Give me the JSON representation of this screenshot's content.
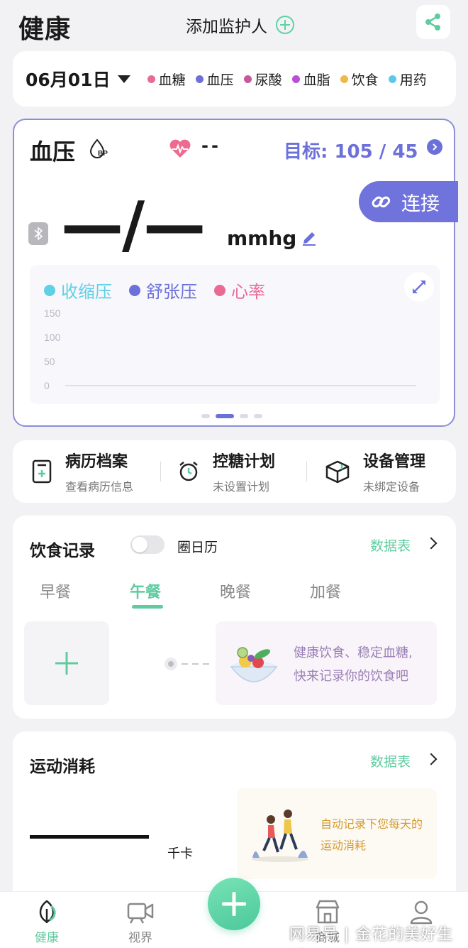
{
  "header": {
    "title": "健康",
    "add_guardian_label": "添加监护人"
  },
  "date_bar": {
    "date": "06月01日",
    "legend": [
      {
        "label": "血糖",
        "color": "#e96b93"
      },
      {
        "label": "血压",
        "color": "#6c70d9"
      },
      {
        "label": "尿酸",
        "color": "#c8569a"
      },
      {
        "label": "血脂",
        "color": "#b84fd6"
      },
      {
        "label": "饮食",
        "color": "#f0b84a"
      },
      {
        "label": "用药",
        "color": "#5cc9ea"
      }
    ]
  },
  "bp_card": {
    "title": "血压",
    "badge": "BP",
    "heart_rate": "--",
    "target_label": "目标:",
    "target_value": "105 / 45",
    "connect_label": "连接",
    "reading": "—/—",
    "unit": "mmhg",
    "chart_legend": [
      {
        "label": "收缩压",
        "color": "#5fd0e6"
      },
      {
        "label": "舒张压",
        "color": "#6c70d9"
      },
      {
        "label": "心率",
        "color": "#e96b93"
      }
    ],
    "accent": "#6c70d9"
  },
  "chart_data": {
    "type": "line",
    "series": [
      {
        "name": "收缩压",
        "values": []
      },
      {
        "name": "舒张压",
        "values": []
      },
      {
        "name": "心率",
        "values": []
      }
    ],
    "yticks": [
      "150",
      "100",
      "50",
      "0"
    ],
    "ylim": [
      0,
      150
    ],
    "grid": false,
    "legend": "top-left"
  },
  "menu": [
    {
      "title": "病历档案",
      "subtitle": "查看病历信息",
      "icon": "medical-record-icon"
    },
    {
      "title": "控糖计划",
      "subtitle": "未设置计划",
      "icon": "alarm-clock-icon"
    },
    {
      "title": "设备管理",
      "subtitle": "未绑定设备",
      "icon": "box-icon"
    }
  ],
  "diet": {
    "title": "饮食记录",
    "toggle_label": "圈日历",
    "data_link": "数据表",
    "tabs": [
      "早餐",
      "午餐",
      "晚餐",
      "加餐"
    ],
    "active_tab": "午餐",
    "tip_line1": "健康饮食、稳定血糖,",
    "tip_line2": "快来记录你的饮食吧"
  },
  "sport": {
    "title": "运动消耗",
    "data_link": "数据表",
    "unit": "千卡",
    "tip_line1": "自动记录下您每天的",
    "tip_line2": "运动消耗"
  },
  "nav": [
    {
      "label": "健康",
      "active": true
    },
    {
      "label": "视界",
      "active": false
    },
    {
      "label": "商城",
      "active": false
    },
    {
      "label": "",
      "active": false
    }
  ],
  "watermark": "网易号 | 金花的美好生活"
}
